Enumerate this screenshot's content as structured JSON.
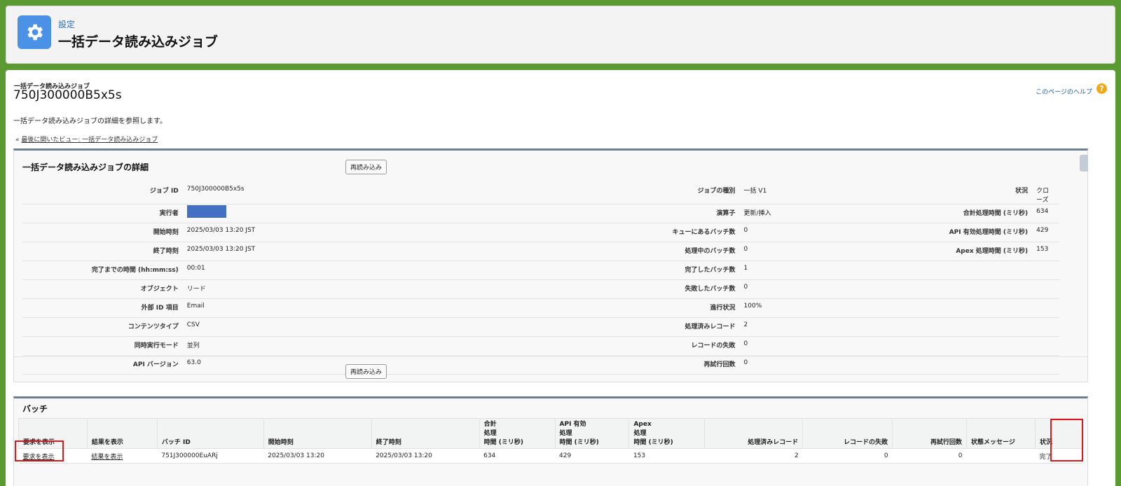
{
  "header": {
    "crumb": "設定",
    "title": "一括データ読み込みジョブ",
    "icon": "gear-icon",
    "icon_color": "#4b92e6"
  },
  "page": {
    "pre_title": "一括データ読み込みジョブ",
    "job_id": "750J300000B5x5s",
    "help_link": "このページのヘルプ",
    "help_icon": "?",
    "description": "一括データ読み込みジョブの詳細を参照します。",
    "back_prefix": "« ",
    "back_link": "最後に開いたビュー: 一括データ読み込みジョブ"
  },
  "detail": {
    "title": "一括データ読み込みジョブの詳細",
    "reload_label": "再読み込み",
    "rows": [
      [
        "ジョブ ID",
        "750J300000B5x5s",
        "ジョブの種別",
        "一括 V1",
        "状況",
        "クローズ"
      ],
      [
        "実行者",
        "",
        "演算子",
        "更新/挿入",
        "合計処理時間 (ミリ秒)",
        "634"
      ],
      [
        "開始時刻",
        "2025/03/03 13:20 JST",
        "キューにあるバッチ数",
        "0",
        "API 有効処理時間 (ミリ秒)",
        "429"
      ],
      [
        "終了時刻",
        "2025/03/03 13:20 JST",
        "処理中のバッチ数",
        "0",
        "Apex 処理時間 (ミリ秒)",
        "153"
      ],
      [
        "完了までの時間 (hh:mm:ss)",
        "00:01",
        "完了したバッチ数",
        "1",
        "",
        ""
      ],
      [
        "オブジェクト",
        "リード",
        "失敗したバッチ数",
        "0",
        "",
        ""
      ],
      [
        "外部 ID 項目",
        "Email",
        "進行状況",
        "100%",
        "",
        ""
      ],
      [
        "コンテンツタイプ",
        "CSV",
        "処理済みレコード",
        "2",
        "",
        ""
      ],
      [
        "同時実行モード",
        "並列",
        "レコードの失敗",
        "0",
        "",
        ""
      ],
      [
        "API バージョン",
        "63.0",
        "再試行回数",
        "0",
        "",
        ""
      ]
    ]
  },
  "batches": {
    "title": "バッチ",
    "columns": [
      "要求を表示",
      "結果を表示",
      "バッチ ID",
      "開始時刻",
      "終了時刻",
      "合計\n処理\n時間 (ミリ秒)",
      "API 有効\n処理\n時間 (ミリ秒)",
      "Apex\n処理\n時間 (ミリ秒)",
      "処理済みレコード",
      "レコードの失敗",
      "再試行回数",
      "状態メッセージ",
      "状況"
    ],
    "rows": [
      [
        "要求を表示",
        "結果を表示",
        "751J300000EuARj",
        "2025/03/03 13:20",
        "2025/03/03 13:20",
        "634",
        "429",
        "153",
        "2",
        "0",
        "0",
        "",
        "完了"
      ]
    ]
  },
  "colors": {
    "background": "#5b9a32",
    "highlight": "#e0161b",
    "redacted": "#4470c4",
    "link": "#1a5ea8"
  }
}
